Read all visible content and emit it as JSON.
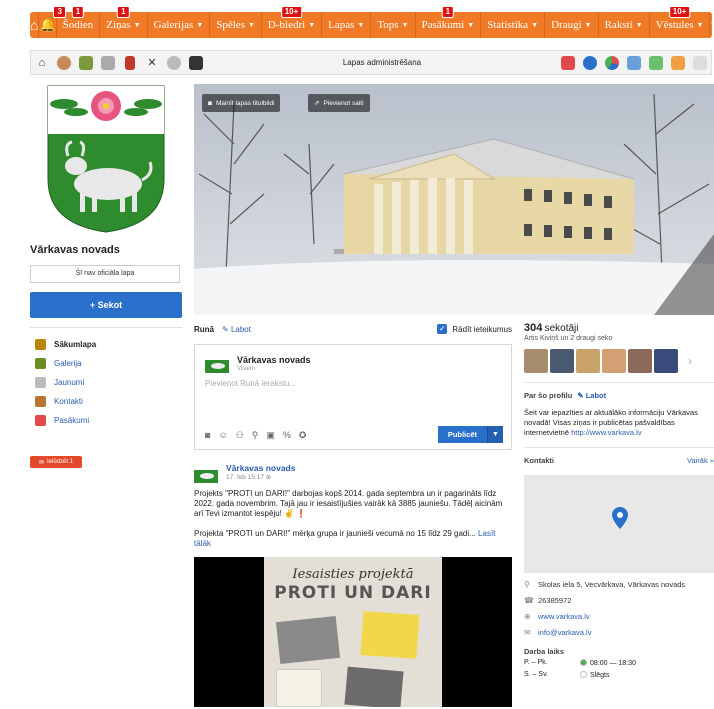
{
  "topnav": {
    "items": [
      {
        "label": "Šodien",
        "caret": false,
        "badge": "1"
      },
      {
        "label": "Ziņas",
        "caret": true,
        "badge": "1"
      },
      {
        "label": "Galerijas",
        "caret": true,
        "badge": ""
      },
      {
        "label": "Spēles",
        "caret": true,
        "badge": ""
      },
      {
        "label": "D-biedri",
        "caret": true,
        "badge": "10+"
      },
      {
        "label": "Lapas",
        "caret": true,
        "badge": ""
      },
      {
        "label": "Tops",
        "caret": true,
        "badge": ""
      },
      {
        "label": "Pasākumi",
        "caret": true,
        "badge": "1"
      },
      {
        "label": "Statistika",
        "caret": true,
        "badge": ""
      },
      {
        "label": "Draugi",
        "caret": true,
        "badge": ""
      },
      {
        "label": "Raksti",
        "caret": true,
        "badge": ""
      },
      {
        "label": "Vēstules",
        "caret": true,
        "badge": "10+"
      }
    ],
    "bell_badge": "3",
    "caret": "▼"
  },
  "toolbar": {
    "title": "Lapas administrēšana"
  },
  "profile": {
    "name": "Vārkavas novads",
    "unofficial_label": "Šī nav oficiāla lapa",
    "follow_label": "+ Sekot",
    "invite_label": "Ielūdzēt",
    "invite_count": "1"
  },
  "sidenav": [
    {
      "label": "Sākumlapa",
      "color": "#b8860b"
    },
    {
      "label": "Galerija",
      "color": "#6b8e23"
    },
    {
      "label": "Jaunumi",
      "color": "#bbbbbb"
    },
    {
      "label": "Kontakti",
      "color": "#b87333"
    },
    {
      "label": "Pasākumi",
      "color": "#e04a4a"
    }
  ],
  "cover": {
    "change_photo_label": "Mainīt lapas titulbildi",
    "add_link_label": "Pievienot saiti"
  },
  "runa": {
    "title": "Runā",
    "edit_label": "Labot",
    "suggestions_label": "Rādīt ieteikumus",
    "author": "Vārkavas novads",
    "audience": "Visiem",
    "placeholder": "Pievienot Runā ierakstu...",
    "publish_label": "Publicēt"
  },
  "post": {
    "author": "Vārkavas novads",
    "date": "17. feb 15:17",
    "paragraph1": "Projekts \"PROTI un DARI!\" darbojas kopš 2014. gada septembra un ir pagarināts līdz 2022. gada novembrim. Tajā jau ir iesaistījušies vairāk kā 3885 jauniešu. Tādēļ aicinām arī Tevi izmantot iespēju! ✌️ ❗",
    "paragraph2": "Projekta \"PROTI un DARI!\" mērķa grupa ir jaunieši vecumā no 15 līdz 29 gadi...",
    "more_label": "Lasīt tālāk",
    "poster_line1": "Iesaisties projektā",
    "poster_line2": "PROTI UN DARI"
  },
  "sidebar": {
    "followers_count": "304",
    "followers_label": "sekotāji",
    "followers_sub": "Artis Kiviņš un 2 draugi seko",
    "about_title": "Par šo profilu",
    "about_edit": "Labot",
    "about_text": "Šeit var iepazīties ar aktuālāko informāciju Vārkavas novadā! Visas ziņas ir publicētas pašvaldības internetvietnē",
    "about_link": "http://www.varkava.lv",
    "contacts_title": "Kontakti",
    "contacts_all": "Vairāk »",
    "address": "Skolas iela 5, Vecvārkava, Vārkavas novads",
    "phone": "26385972",
    "website": "www.varkava.lv",
    "email": "info@varkava.lv",
    "hours_title": "Darba laiks",
    "hours": [
      {
        "days": "P. – Pk.",
        "value": "08:00 — 18:30",
        "color": "#4caf50"
      },
      {
        "days": "S. – Sv.",
        "value": "Slēgts",
        "color": "#ffffff"
      }
    ]
  }
}
